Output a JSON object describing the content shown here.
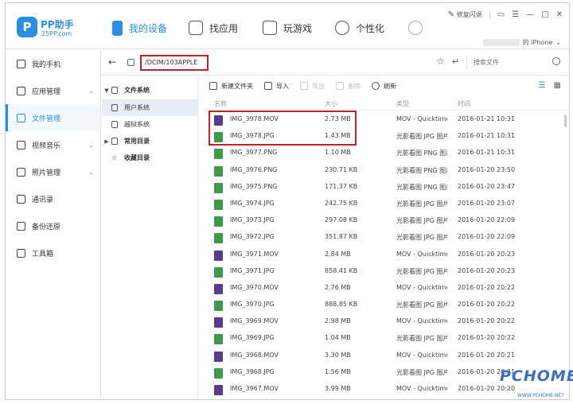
{
  "app": {
    "logo_letter": "P",
    "name": "PP助手",
    "sub": "25PP.com"
  },
  "nav": [
    "我的设备",
    "找应用",
    "玩游戏",
    "个性化"
  ],
  "window": {
    "repair": "修复闪退",
    "device_suffix": "的 iPhone"
  },
  "sidebar": [
    {
      "label": "我的手机",
      "icon": "phone-icon"
    },
    {
      "label": "应用管理",
      "icon": "apps-icon",
      "expand": true
    },
    {
      "label": "文件管理",
      "icon": "folder-icon",
      "active": true
    },
    {
      "label": "视频音乐",
      "icon": "media-icon",
      "expand": true
    },
    {
      "label": "照片管理",
      "icon": "photo-icon",
      "expand": true
    },
    {
      "label": "通讯录",
      "icon": "contacts-icon"
    },
    {
      "label": "备份还原",
      "icon": "backup-icon"
    },
    {
      "label": "工具箱",
      "icon": "toolbox-icon"
    }
  ],
  "path": {
    "value": "/DCIM/103APPLE",
    "search_placeholder": "搜索文件"
  },
  "tree": [
    {
      "label": "文件系统",
      "bold": true,
      "arrow": "▼"
    },
    {
      "label": "用户系统",
      "selected": true
    },
    {
      "label": "越狱系统"
    },
    {
      "label": "常用目录",
      "bold": true,
      "arrow": "▶"
    },
    {
      "label": "收藏目录",
      "bold": true
    }
  ],
  "toolbar": {
    "new_folder": "新建文件夹",
    "import": "导入",
    "export": "导出",
    "delete": "删除",
    "refresh": "刷新"
  },
  "columns": {
    "name": "名称",
    "size": "大小",
    "type": "类型",
    "time": "时间"
  },
  "files": [
    {
      "name": "IMG_3978.MOV",
      "size": "2.73 MB",
      "type": "MOV - Quicktime",
      "time": "2016-01-21 10:31",
      "kind": "mov"
    },
    {
      "name": "IMG_3978.JPG",
      "size": "1.43 MB",
      "type": "光影看图 JPG 图片",
      "time": "2016-01-21 10:31",
      "kind": "img"
    },
    {
      "name": "IMG_3977.PNG",
      "size": "1.10 MB",
      "type": "光影看图 PNG 图片",
      "time": "2016-01-21 10:31",
      "kind": "img"
    },
    {
      "name": "IMG_3976.PNG",
      "size": "230.71 KB",
      "type": "光影看图 PNG 图片",
      "time": "2016-01-20 23:50",
      "kind": "img"
    },
    {
      "name": "IMG_3975.PNG",
      "size": "171.37 KB",
      "type": "光影看图 PNG 图片",
      "time": "2016-01-20 23:47",
      "kind": "img"
    },
    {
      "name": "IMG_3974.JPG",
      "size": "242.75 KB",
      "type": "光影看图 JPG 图片",
      "time": "2016-01-20 23:07",
      "kind": "img"
    },
    {
      "name": "IMG_3973.JPG",
      "size": "297.08 KB",
      "type": "光影看图 JPG 图片",
      "time": "2016-01-20 22:09",
      "kind": "img"
    },
    {
      "name": "IMG_3972.JPG",
      "size": "351.87 KB",
      "type": "光影看图 JPG 图片",
      "time": "2016-01-20 22:09",
      "kind": "img"
    },
    {
      "name": "IMG_3971.MOV",
      "size": "2.84 MB",
      "type": "MOV - Quicktime",
      "time": "2016-01-20 20:23",
      "kind": "mov"
    },
    {
      "name": "IMG_3971.JPG",
      "size": "858.41 KB",
      "type": "光影看图 JPG 图片",
      "time": "2016-01-20 20:23",
      "kind": "img"
    },
    {
      "name": "IMG_3970.MOV",
      "size": "2.76 MB",
      "type": "MOV - Quicktime",
      "time": "2016-01-20 20:22",
      "kind": "mov"
    },
    {
      "name": "IMG_3970.JPG",
      "size": "888.85 KB",
      "type": "光影看图 JPG 图片",
      "time": "2016-01-20 20:22",
      "kind": "img"
    },
    {
      "name": "IMG_3969.MOV",
      "size": "2.98 MB",
      "type": "MOV - Quicktime",
      "time": "2016-01-20 20:22",
      "kind": "mov"
    },
    {
      "name": "IMG_3969.JPG",
      "size": "1.04 MB",
      "type": "光影看图 JPG 图片",
      "time": "2016-01-20 20:22",
      "kind": "img"
    },
    {
      "name": "IMG_3968.MOV",
      "size": "3.30 MB",
      "type": "MOV - Quicktime",
      "time": "2016-01-20 20:21",
      "kind": "mov"
    },
    {
      "name": "IMG_3968.JPG",
      "size": "1.56 MB",
      "type": "光影看图 JPG 图片",
      "time": "2016-01-20 20:21",
      "kind": "img"
    },
    {
      "name": "IMG_3967.MOV",
      "size": "3.99 MB",
      "type": "MOV - Quicktime",
      "time": "2016-01-20 20:20",
      "kind": "mov"
    }
  ],
  "watermark": {
    "text": "PCHOME",
    "url": "WWW.PCHOME.NET"
  }
}
